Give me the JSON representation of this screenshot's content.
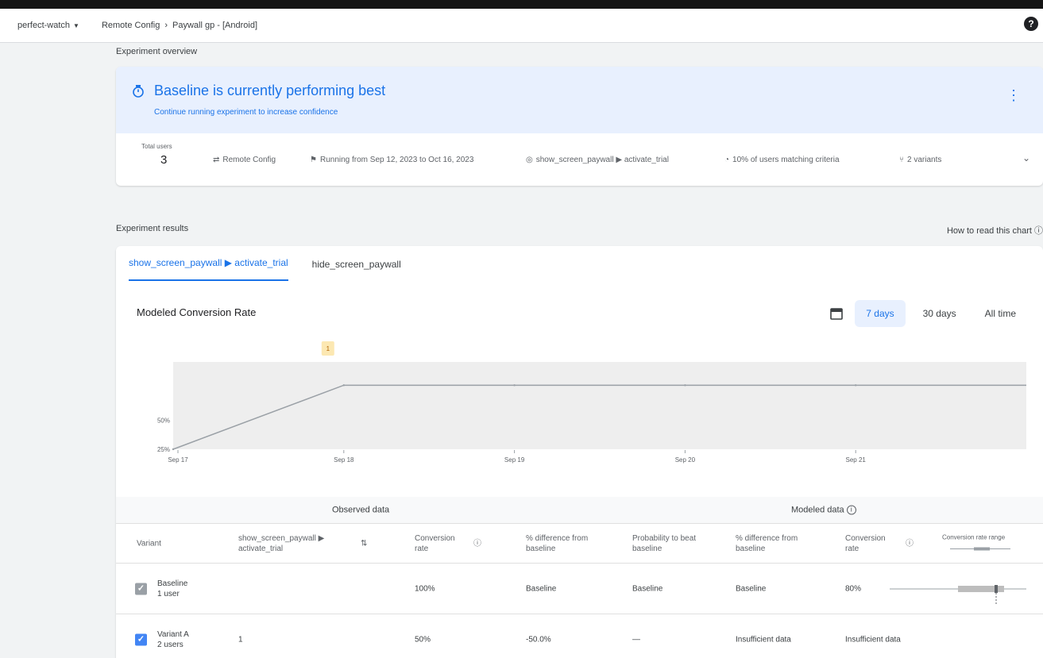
{
  "topbar": {
    "project": "perfect-watch",
    "breadcrumb": [
      "Remote Config",
      "Paywall gp - [Android]"
    ],
    "help": "?"
  },
  "overview": {
    "section_label": "Experiment overview",
    "banner_title": "Baseline is currently performing best",
    "banner_subtitle": "Continue running experiment to increase confidence",
    "stats": {
      "total_users_label": "Total users",
      "total_users_value": "3",
      "service": "Remote Config",
      "running": "Running from Sep 12, 2023 to Oct 16, 2023",
      "goal": "show_screen_paywall ▶ activate_trial",
      "audience": "10% of users matching criteria",
      "variants": "2 variants"
    }
  },
  "results": {
    "section_label": "Experiment results",
    "howto": "How to read this chart",
    "tabs": [
      "show_screen_paywall ▶ activate_trial",
      "hide_screen_paywall"
    ],
    "chart_title": "Modeled Conversion Rate",
    "ranges": [
      "7 days",
      "30 days",
      "All time"
    ]
  },
  "chart_data": {
    "type": "line",
    "title": "Modeled Conversion Rate",
    "x": [
      "Sep 17",
      "Sep 18",
      "Sep 19",
      "Sep 20",
      "Sep 21"
    ],
    "series": [
      {
        "values": [
          25,
          80,
          80,
          80,
          80
        ]
      }
    ],
    "band": {
      "lower": [
        25,
        25,
        25,
        25,
        25
      ],
      "upper": [
        100,
        100,
        100,
        100,
        100
      ]
    },
    "yticks": [
      "50%",
      "25%"
    ],
    "ylim": [
      25,
      100
    ],
    "annotation": "1"
  },
  "table": {
    "observed_group": "Observed data",
    "modeled_group": "Modeled data",
    "headers": [
      "Variant",
      "show_screen_paywall ▶ activate_trial",
      "Conversion rate",
      "% difference from baseline",
      "Probability to beat baseline",
      "% difference from baseline",
      "Conversion rate",
      "Conversion rate range"
    ],
    "rows": [
      {
        "variant": "Baseline",
        "users": "1 user",
        "count": "",
        "obs_rate": "100%",
        "obs_diff": "Baseline",
        "prob": "Baseline",
        "mod_diff": "Baseline",
        "mod_rate": "80%",
        "checked": true,
        "color": "#9aa0a6"
      },
      {
        "variant": "Variant A",
        "users": "2 users",
        "count": "1",
        "obs_rate": "50%",
        "obs_diff": "-50.0%",
        "prob": "—",
        "mod_diff": "Insufficient data",
        "mod_rate": "Insufficient data",
        "checked": true,
        "color": "#4285f4"
      }
    ]
  }
}
